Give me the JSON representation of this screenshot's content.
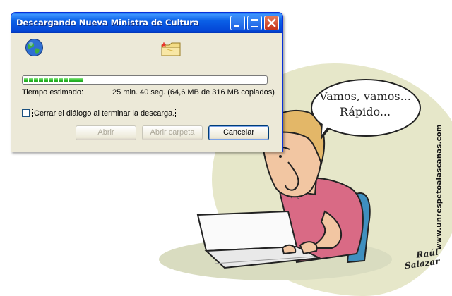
{
  "dialog": {
    "title": "Descargando Nueva Ministra de Cultura",
    "progress_fraction": 0.26,
    "time_label": "Tiempo estimado:",
    "time_value": "25 min. 40 seg. (64,6 MB de 316 MB copiados)",
    "close_on_finish_label": "Cerrar el diálogo al terminar la descarga.",
    "close_on_finish_checked": false,
    "buttons": {
      "open": "Abrir",
      "open_folder": "Abrir carpeta",
      "cancel": "Cancelar"
    },
    "icons": [
      "globe-icon",
      "folder-icon"
    ]
  },
  "cartoon": {
    "speech_line1": "Vamos, vamos...",
    "speech_line2": "Rápido...",
    "site": "www.unrespetoalascanas.com",
    "signature_line1": "Raúl",
    "signature_line2": "Salazar"
  },
  "colors": {
    "titlebar": "#0a5fe6",
    "window_bg": "#ece9d8",
    "progress": "#2bc02b",
    "blob": "#e6e7c9"
  }
}
